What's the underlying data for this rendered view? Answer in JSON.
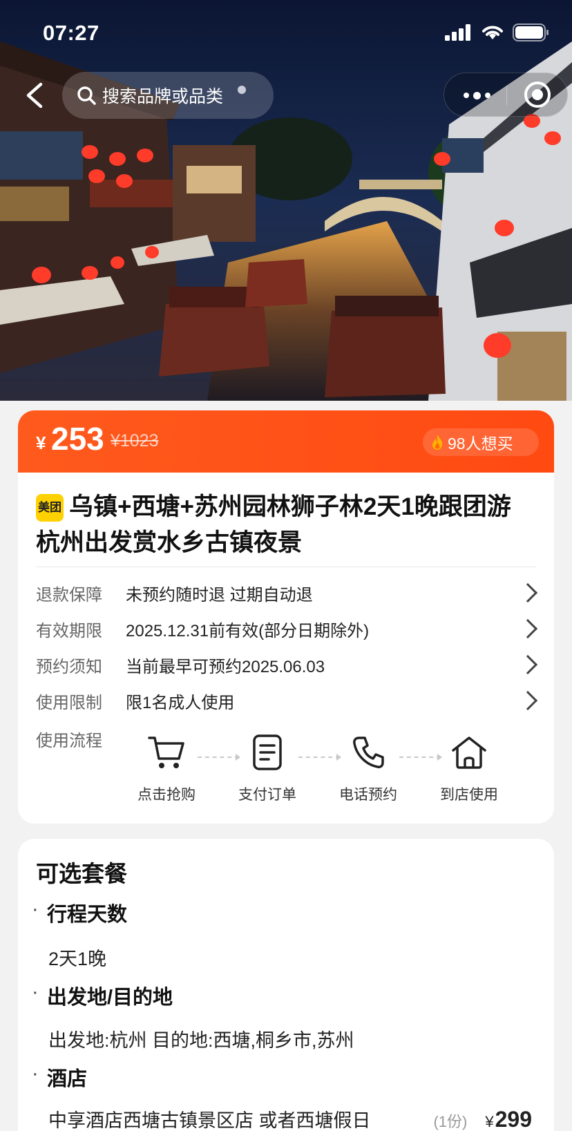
{
  "status_bar": {
    "time": "07:27"
  },
  "nav": {
    "search_placeholder": "搜索品牌或品类"
  },
  "deal": {
    "currency": "¥",
    "price": "253",
    "original_price": "¥1023",
    "want_count": "98人想买",
    "brand_badge": "美团",
    "title": "乌镇+西塘+苏州园林狮子林2天1晚跟团游 杭州出发赏水乡古镇夜景"
  },
  "info_rows": [
    {
      "label": "退款保障",
      "value": "未预约随时退 过期自动退"
    },
    {
      "label": "有效期限",
      "value": "2025.12.31前有效(部分日期除外)"
    },
    {
      "label": "预约须知",
      "value": "当前最早可预约2025.06.03"
    },
    {
      "label": "使用限制",
      "value": "限1名成人使用"
    }
  ],
  "flow": {
    "label": "使用流程",
    "steps": [
      {
        "icon": "cart-icon",
        "label": "点击抢购"
      },
      {
        "icon": "document-icon",
        "label": "支付订单"
      },
      {
        "icon": "phone-icon",
        "label": "电话预约"
      },
      {
        "icon": "home-icon",
        "label": "到店使用"
      }
    ]
  },
  "packages": {
    "title": "可选套餐",
    "sections": [
      {
        "heading": "行程天数",
        "value": "2天1晚"
      },
      {
        "heading": "出发地/目的地",
        "value": "出发地:杭州 目的地:西塘,桐乡市,苏州"
      },
      {
        "heading": "酒店"
      }
    ],
    "hotel": {
      "name": "中享酒店西塘古镇景区店 或者西塘假日",
      "qty": "(1份)",
      "currency": "¥",
      "price": "299"
    }
  },
  "colors": {
    "accent": "#ff5319",
    "brand_yellow": "#ffd100"
  }
}
